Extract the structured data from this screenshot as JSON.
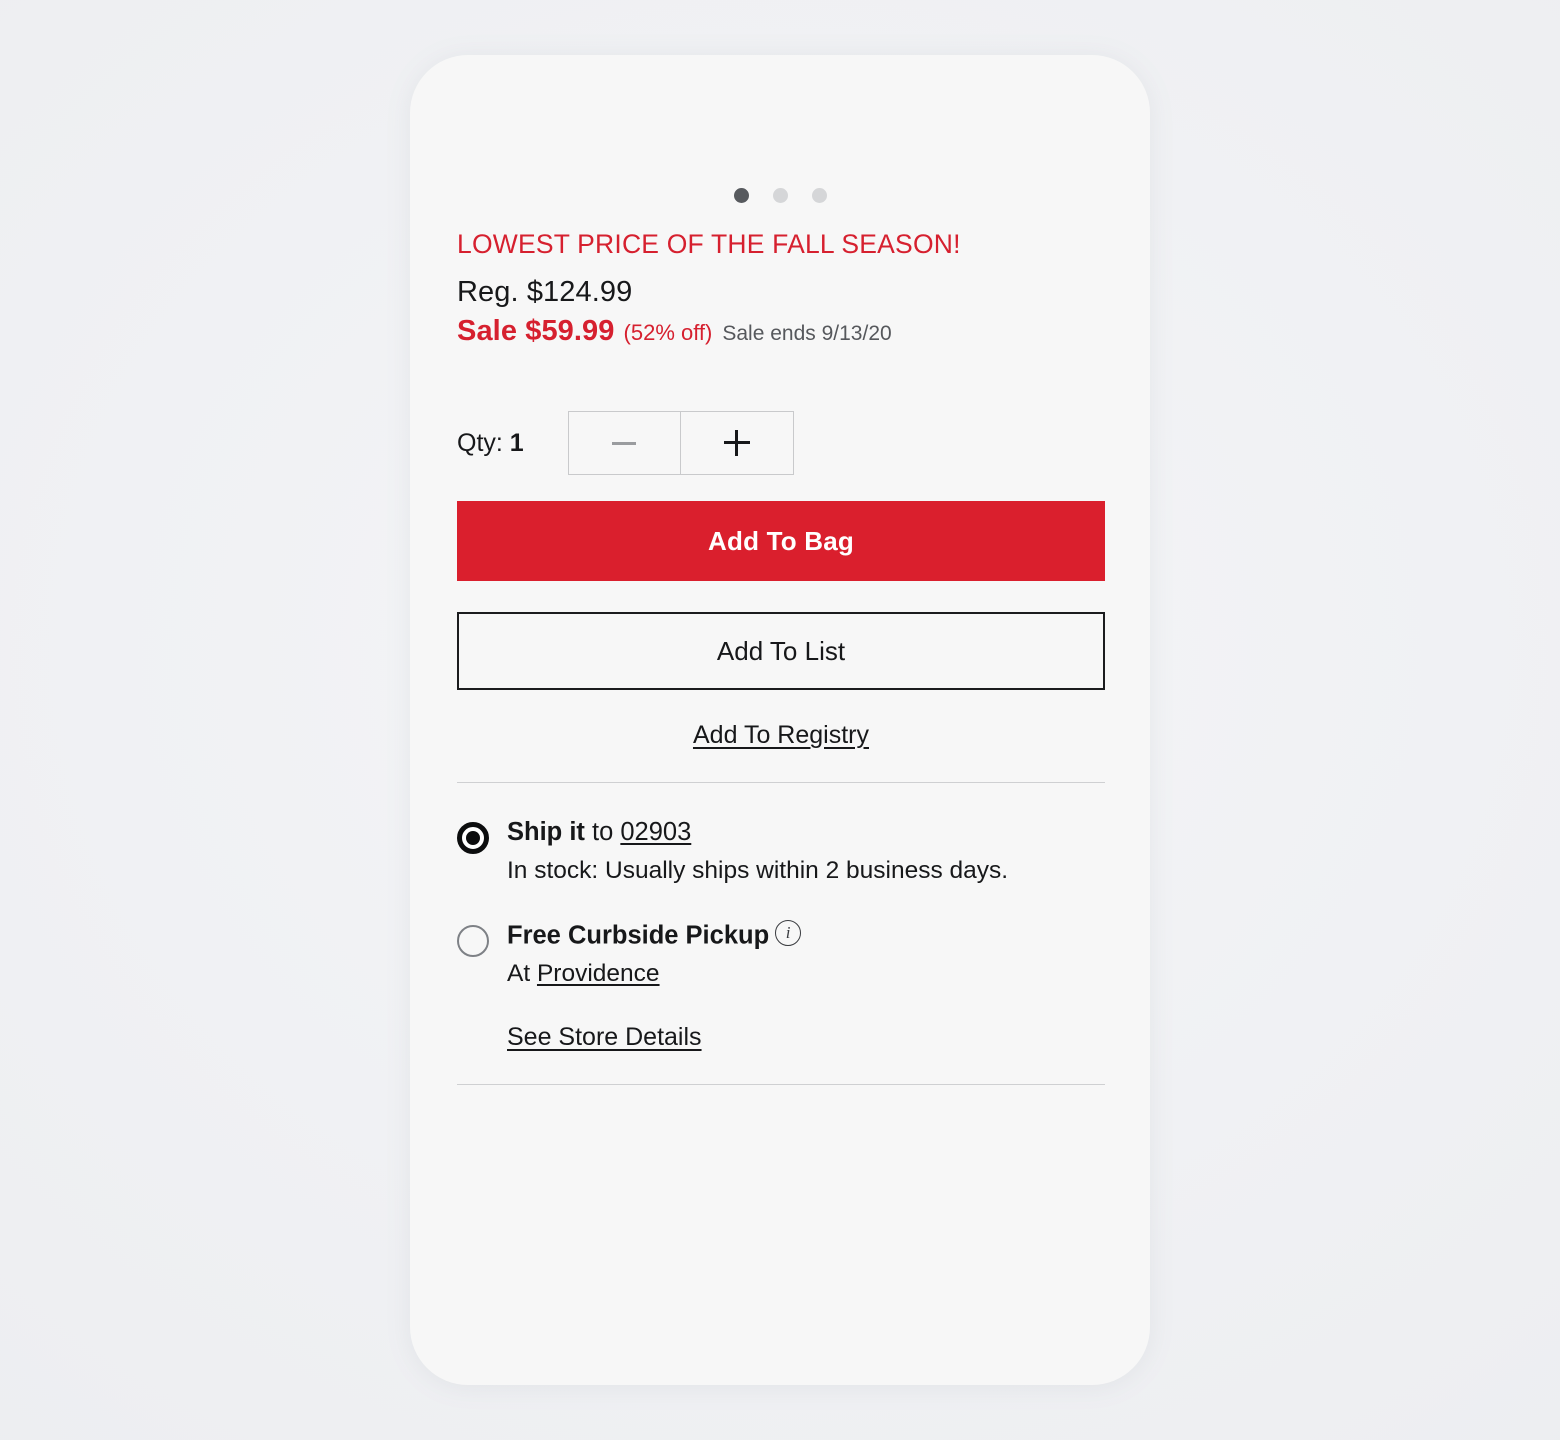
{
  "carousel": {
    "dots": [
      {
        "name": "dot-1",
        "active": true
      },
      {
        "name": "dot-2",
        "active": false
      },
      {
        "name": "dot-3",
        "active": false
      }
    ]
  },
  "pricing": {
    "promo_headline": "LOWEST PRICE OF THE FALL SEASON!",
    "regular_price": "Reg. $124.99",
    "sale_price": "Sale $59.99",
    "discount_percent": "(52% off)",
    "sale_ends": "Sale ends 9/13/20",
    "promo_color": "#d6202f",
    "sale_color": "#d6202f"
  },
  "quantity": {
    "label_prefix": "Qty: ",
    "value": "1",
    "decrease_icon": "minus-icon",
    "increase_icon": "plus-icon"
  },
  "actions": {
    "add_to_bag": "Add To Bag",
    "add_to_bag_color": "#da1f2d",
    "add_to_list": "Add To List",
    "add_to_registry": "Add To Registry"
  },
  "fulfillment": {
    "ship": {
      "title_bold": "Ship it",
      "title_mid": " to ",
      "zip": "02903",
      "status": "In stock: Usually ships within 2 business days.",
      "selected": true
    },
    "pickup": {
      "title_bold": "Free Curbside Pickup",
      "info_icon": "info-icon",
      "at_prefix": "At ",
      "store": "Providence",
      "selected": false
    },
    "store_details_link": "See Store Details"
  }
}
